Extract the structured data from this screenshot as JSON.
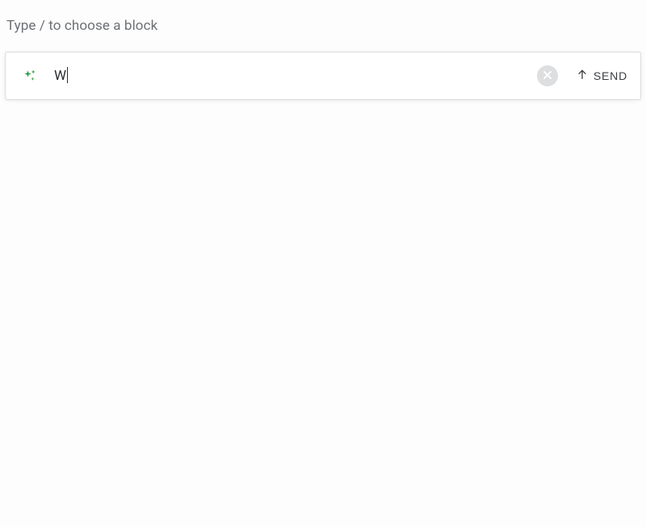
{
  "hint": "Type / to choose a block",
  "input": {
    "value": "W"
  },
  "send_label": "SEND",
  "icons": {
    "sparkle": "sparkle-icon",
    "clear": "close-icon",
    "send_arrow": "arrow-up-icon"
  },
  "colors": {
    "accent_green": "#1f9d3a",
    "clear_bg": "#dcdedf",
    "clear_x": "#ffffff",
    "text_muted": "#6b7075",
    "border": "#d9dcdf"
  }
}
